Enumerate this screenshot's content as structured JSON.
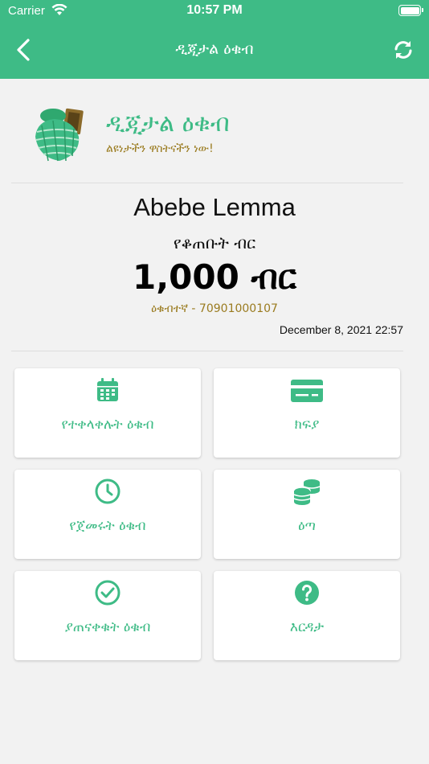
{
  "status_bar": {
    "carrier": "Carrier",
    "time": "10:57 PM"
  },
  "header": {
    "title": "ዲጂታል ዕቁብ",
    "back_icon": "chevron-left-icon",
    "refresh_icon": "refresh-icon",
    "color": "#3ebb86"
  },
  "brand": {
    "name": "ዲጂታል ዕቁብ",
    "tagline": "ልዩነታችን ዋስትናችን ነው!",
    "name_color": "#3ebb86",
    "tagline_color": "#9a7b1f"
  },
  "account": {
    "name": "Abebe Lemma",
    "saved_label": "የቆጠቡት ብር",
    "amount": "1,000 ብር",
    "member_label": "ዕቁብተኛ  - 70901000107",
    "date": "December 8, 2021 22:57"
  },
  "menu": [
    {
      "label": "የተቀላቀሉት ዕቁብ",
      "icon": "calendar-icon"
    },
    {
      "label": "ክፍያ",
      "icon": "credit-card-icon"
    },
    {
      "label": "የጀመሩት ዕቁብ",
      "icon": "clock-icon"
    },
    {
      "label": "ዕጣ",
      "icon": "coins-icon"
    },
    {
      "label": "ያጠናቀቁት ዕቁብ",
      "icon": "check-circle-icon"
    },
    {
      "label": "እርዳታ",
      "icon": "question-circle-icon"
    }
  ]
}
